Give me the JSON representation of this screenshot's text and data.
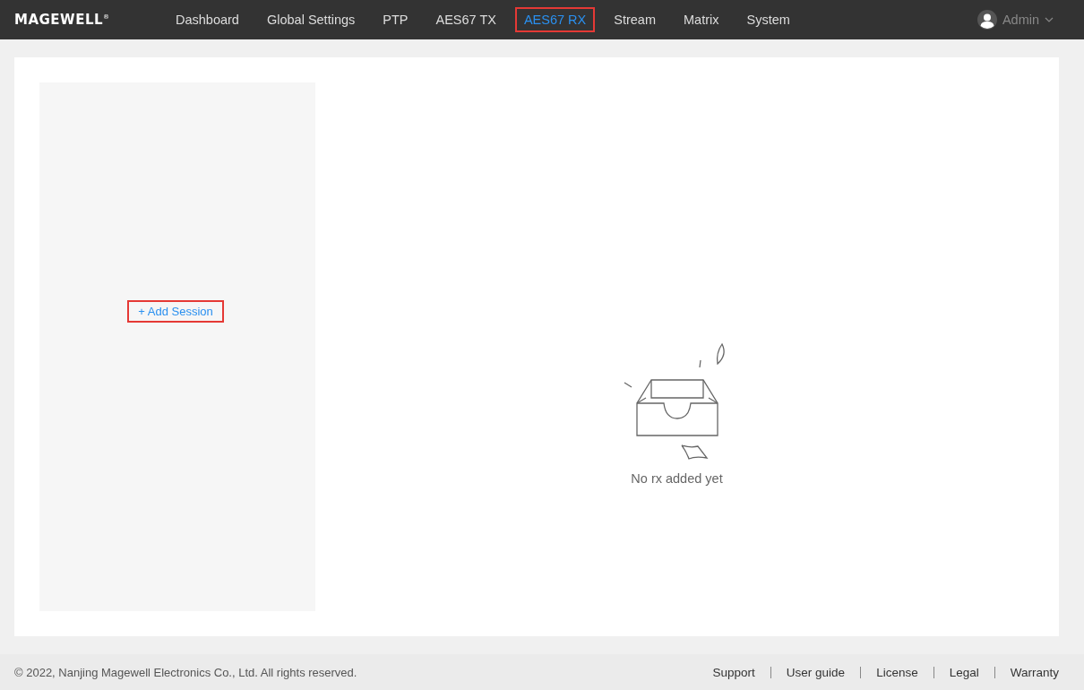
{
  "header": {
    "logo": "MAGEWELL",
    "logo_mark": "®",
    "nav": [
      {
        "label": "Dashboard",
        "selected": false,
        "highlighted": false
      },
      {
        "label": "Global Settings",
        "selected": false,
        "highlighted": false
      },
      {
        "label": "PTP",
        "selected": false,
        "highlighted": false
      },
      {
        "label": "AES67 TX",
        "selected": false,
        "highlighted": false
      },
      {
        "label": "AES67 RX",
        "selected": true,
        "highlighted": true
      },
      {
        "label": "Stream",
        "selected": false,
        "highlighted": false
      },
      {
        "label": "Matrix",
        "selected": false,
        "highlighted": false
      },
      {
        "label": "System",
        "selected": false,
        "highlighted": false
      }
    ],
    "user": "Admin"
  },
  "sidebar": {
    "add_session": {
      "label": "+ Add Session",
      "highlighted": true
    }
  },
  "empty_state": {
    "message": "No rx added yet"
  },
  "footer": {
    "copyright": "© 2022, Nanjing Magewell Electronics Co., Ltd. All rights reserved.",
    "links": [
      "Support",
      "User guide",
      "License",
      "Legal",
      "Warranty"
    ]
  }
}
